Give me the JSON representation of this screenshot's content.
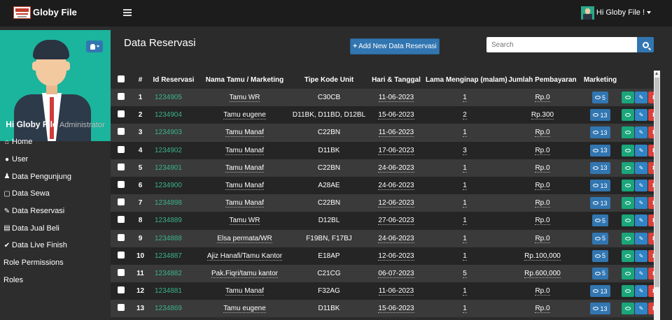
{
  "brand": {
    "name": "Globy File"
  },
  "topbar": {
    "user_label": "Hi Globy File !"
  },
  "sidebar": {
    "greeting": "Hi Globy File",
    "role": "Administrator",
    "items": [
      {
        "label": "Home",
        "icon": "home-icon"
      },
      {
        "label": "User",
        "icon": "user-icon"
      },
      {
        "label": "Data Pengunjung",
        "icon": "person-icon"
      },
      {
        "label": "Data Sewa",
        "icon": "file-icon"
      },
      {
        "label": "Data Reservasi",
        "icon": "edit-icon"
      },
      {
        "label": "Data Jual Beli",
        "icon": "book-icon"
      },
      {
        "label": "Data Live Finish",
        "icon": "check-circle-icon"
      },
      {
        "label": "Role Permissions",
        "icon": ""
      },
      {
        "label": "Roles",
        "icon": ""
      }
    ]
  },
  "main": {
    "title": "Data Reservasi",
    "add_button": "Add New Data Reservasi",
    "search_placeholder": "Search"
  },
  "table": {
    "columns": [
      "#",
      "Id Reservasi",
      "Nama Tamu / Marketing",
      "Tipe Kode Unit",
      "Hari & Tanggal",
      "Lama Menginap (malam)",
      "Jumlah Pembayaran",
      "Marketing"
    ],
    "rows": [
      {
        "no": "1",
        "id": "1234905",
        "nama": "Tamu WR",
        "unit": "C30CB",
        "tanggal": "11-06-2023",
        "lama": "1",
        "jumlah": "Rp.0",
        "marketing": "5"
      },
      {
        "no": "2",
        "id": "1234904",
        "nama": "Tamu eugene",
        "unit": "D11BK, D11BD, D12BL",
        "tanggal": "15-06-2023",
        "lama": "2",
        "jumlah": "Rp.300",
        "marketing": "13"
      },
      {
        "no": "3",
        "id": "1234903",
        "nama": "Tamu Manaf",
        "unit": "C22BN",
        "tanggal": "11-06-2023",
        "lama": "1",
        "jumlah": "Rp.0",
        "marketing": "13"
      },
      {
        "no": "4",
        "id": "1234902",
        "nama": "Tamu Manaf",
        "unit": "D11BK",
        "tanggal": "17-06-2023",
        "lama": "3",
        "jumlah": "Rp.0",
        "marketing": "13"
      },
      {
        "no": "5",
        "id": "1234901",
        "nama": "Tamu Manaf",
        "unit": "C22BN",
        "tanggal": "24-06-2023",
        "lama": "1",
        "jumlah": "Rp.0",
        "marketing": "13"
      },
      {
        "no": "6",
        "id": "1234900",
        "nama": "Tamu Manaf",
        "unit": "A28AE",
        "tanggal": "24-06-2023",
        "lama": "1",
        "jumlah": "Rp.0",
        "marketing": "13"
      },
      {
        "no": "7",
        "id": "1234898",
        "nama": "Tamu Manaf",
        "unit": "C22BN",
        "tanggal": "12-06-2023",
        "lama": "1",
        "jumlah": "Rp.0",
        "marketing": "13"
      },
      {
        "no": "8",
        "id": "1234889",
        "nama": "Tamu WR",
        "unit": "D12BL",
        "tanggal": "27-06-2023",
        "lama": "1",
        "jumlah": "Rp.0",
        "marketing": "5"
      },
      {
        "no": "9",
        "id": "1234888",
        "nama": "Elsa permata/WR",
        "unit": "F19BN, F17BJ",
        "tanggal": "24-06-2023",
        "lama": "1",
        "jumlah": "Rp.0",
        "marketing": "5"
      },
      {
        "no": "10",
        "id": "1234887",
        "nama": "Ajiz Hanafi/Tamu Kantor",
        "unit": "E18AP",
        "tanggal": "12-06-2023",
        "lama": "1",
        "jumlah": "Rp.100,000",
        "marketing": "5"
      },
      {
        "no": "11",
        "id": "1234882",
        "nama": "Pak.Fiqri/tamu kantor",
        "unit": "C21CG",
        "tanggal": "06-07-2023",
        "lama": "5",
        "jumlah": "Rp.600,000",
        "marketing": "5"
      },
      {
        "no": "12",
        "id": "1234881",
        "nama": "Tamu Manaf",
        "unit": "F32AG",
        "tanggal": "11-06-2023",
        "lama": "1",
        "jumlah": "Rp.0",
        "marketing": "13"
      },
      {
        "no": "13",
        "id": "1234869",
        "nama": "Tamu eugene",
        "unit": "D11BK",
        "tanggal": "15-06-2023",
        "lama": "1",
        "jumlah": "Rp.0",
        "marketing": "13"
      }
    ]
  },
  "colors": {
    "accent": "#3276b1",
    "link": "#3ab38a",
    "view": "#1aa67a",
    "edit": "#3083c4",
    "delete": "#d9423d",
    "avatar_bg": "#1bb49c"
  }
}
